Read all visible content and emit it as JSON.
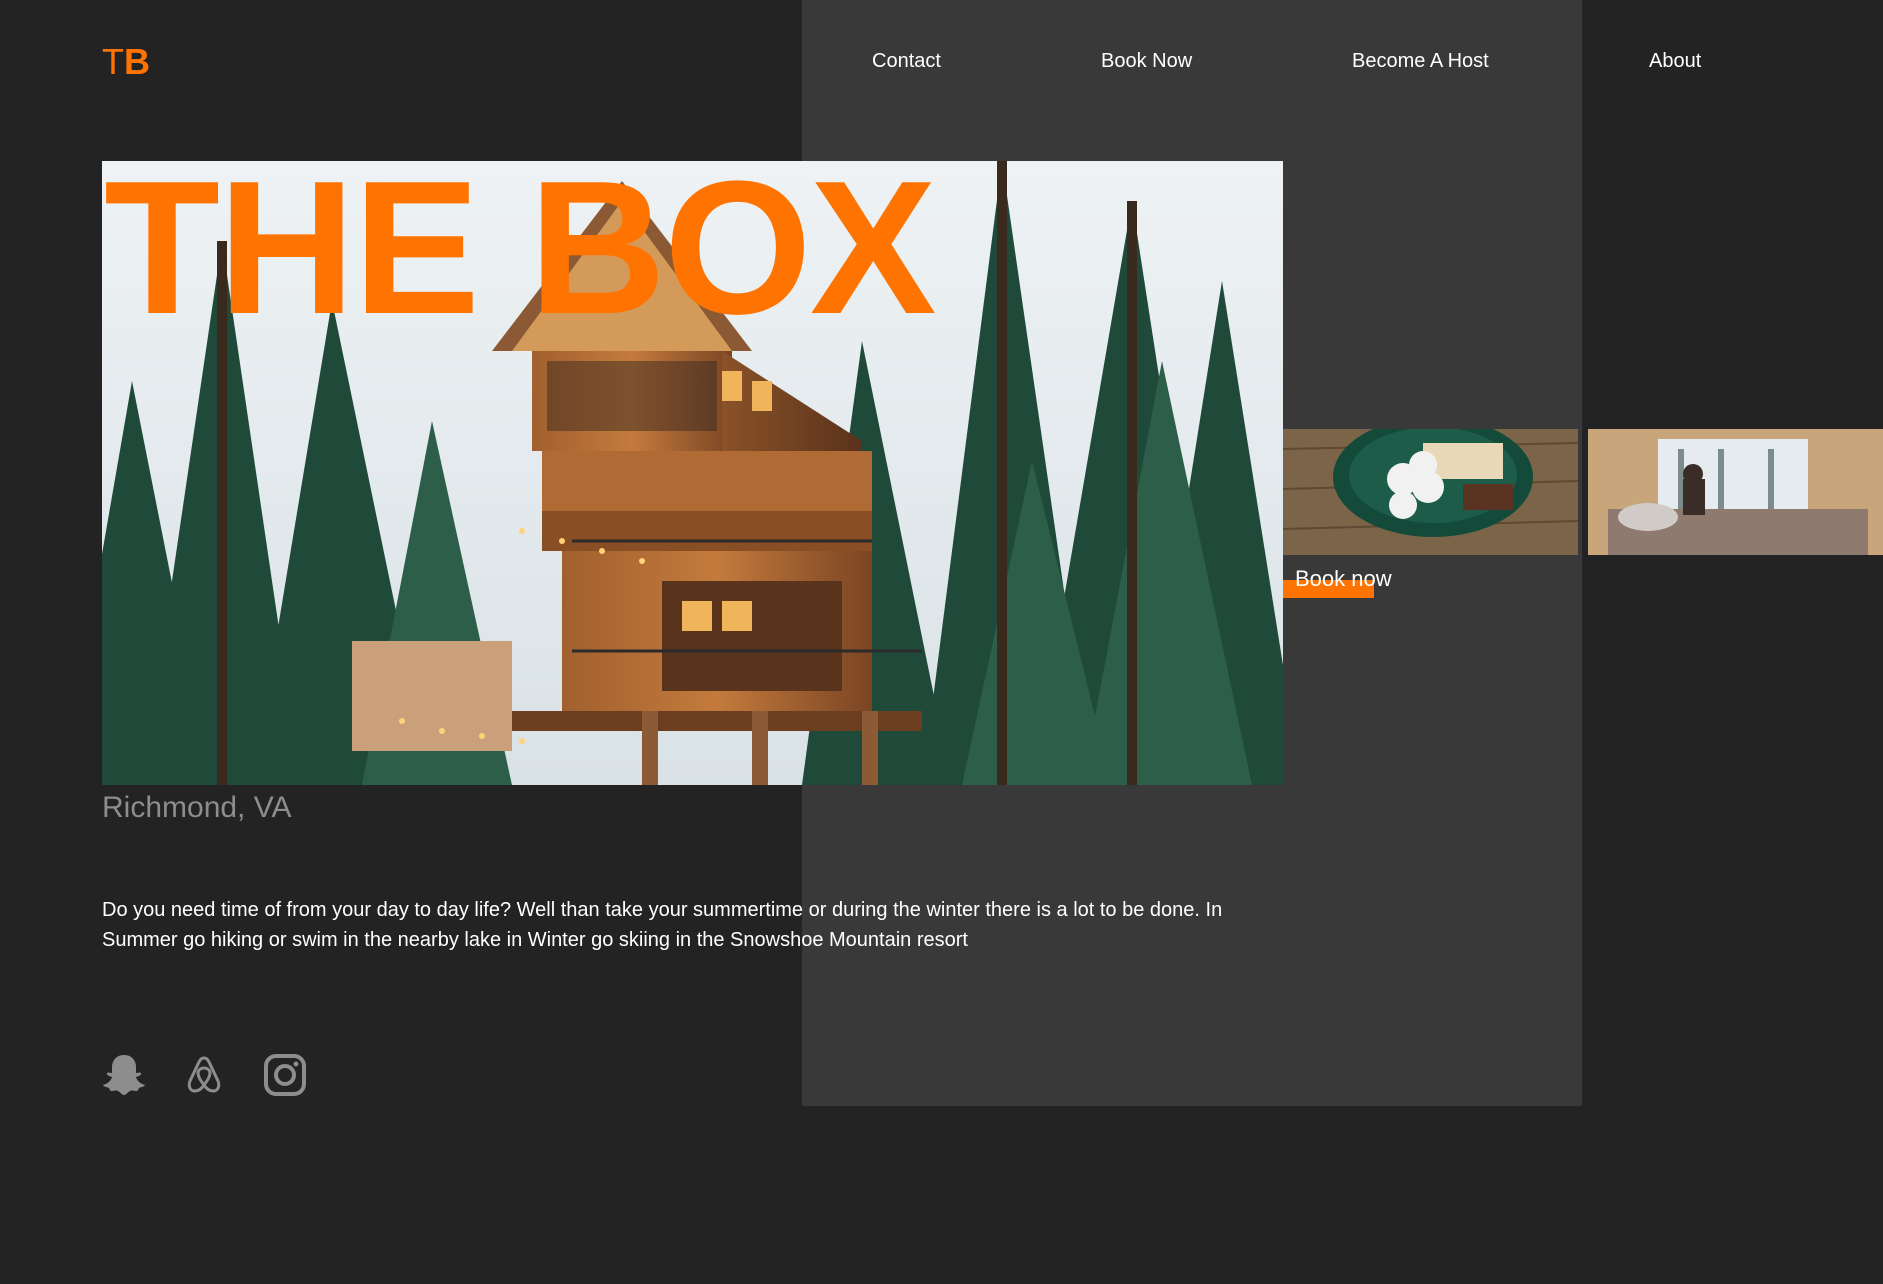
{
  "brand": {
    "logo_t": "T",
    "logo_b": "B",
    "accent": "#ff7400"
  },
  "nav": {
    "items": [
      {
        "label": "Contact"
      },
      {
        "label": "Book Now"
      },
      {
        "label": "Become A Host"
      },
      {
        "label": "About"
      }
    ]
  },
  "hero": {
    "title": "THE BOX",
    "location": "Richmond, VA",
    "description": "Do you need time of from your day to day life? Well than take your summertime or during the winter there is a lot to be done. In Summer go hiking or swim in the nearby lake in Winter go skiing in the Snowshoe Mountain resort"
  },
  "gallery": {
    "book_label": "Book now"
  },
  "social": [
    {
      "icon": "snapchat-icon"
    },
    {
      "icon": "airbnb-icon"
    },
    {
      "icon": "instagram-icon"
    }
  ],
  "colors": {
    "background": "#232323",
    "panel": "#393939",
    "muted_text": "#8d8d8d"
  }
}
